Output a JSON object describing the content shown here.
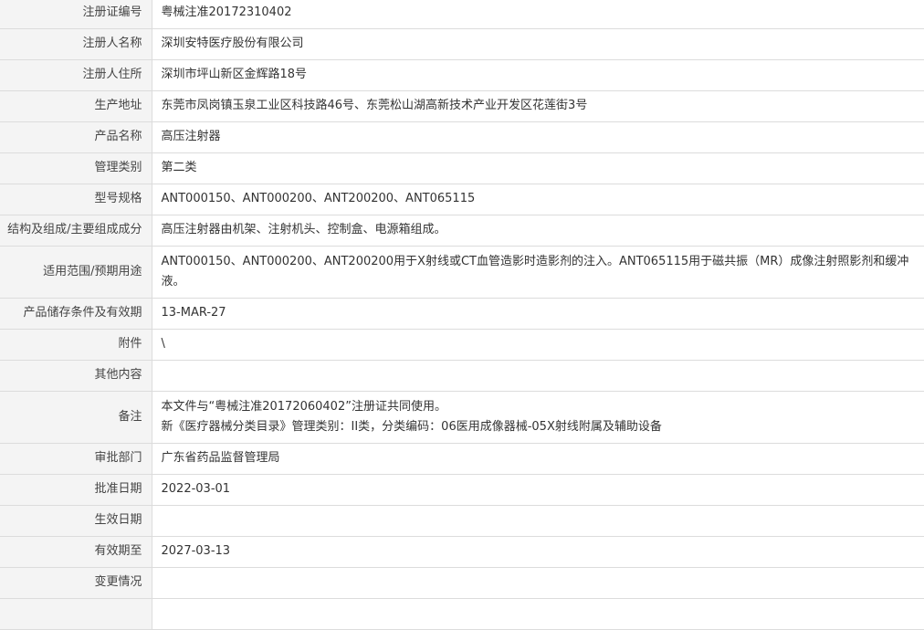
{
  "rows": [
    {
      "label": "注册证编号",
      "value": "粤械注准20172310402"
    },
    {
      "label": "注册人名称",
      "value": "深圳安特医疗股份有限公司"
    },
    {
      "label": "注册人住所",
      "value": "深圳市坪山新区金辉路18号"
    },
    {
      "label": "生产地址",
      "value": "东莞市凤岗镇玉泉工业区科技路46号、东莞松山湖高新技术产业开发区花莲街3号"
    },
    {
      "label": "产品名称",
      "value": "高压注射器"
    },
    {
      "label": "管理类别",
      "value": "第二类"
    },
    {
      "label": "型号规格",
      "value": "ANT000150、ANT000200、ANT200200、ANT065115"
    },
    {
      "label": "结构及组成/主要组成成分",
      "value": "高压注射器由机架、注射机头、控制盒、电源箱组成。"
    },
    {
      "label": "适用范围/预期用途",
      "value": "ANT000150、ANT000200、ANT200200用于X射线或CT血管造影时造影剂的注入。ANT065115用于磁共振（MR）成像注射照影剂和缓冲液。"
    },
    {
      "label": "产品储存条件及有效期",
      "value": "13-MAR-27"
    },
    {
      "label": "附件",
      "value": "\\"
    },
    {
      "label": "其他内容",
      "value": ""
    },
    {
      "label": "备注",
      "value_line1": "本文件与“粤械注准20172060402”注册证共同使用。",
      "value_line2": "新《医疗器械分类目录》管理类别：II类，分类编码：06医用成像器械-05X射线附属及辅助设备"
    },
    {
      "label": "审批部门",
      "value": "广东省药品监督管理局"
    },
    {
      "label": "批准日期",
      "value": "2022-03-01"
    },
    {
      "label": "生效日期",
      "value": ""
    },
    {
      "label": "有效期至",
      "value": "2027-03-13"
    },
    {
      "label": "变更情况",
      "value": ""
    },
    {
      "label": "",
      "value": ""
    }
  ]
}
